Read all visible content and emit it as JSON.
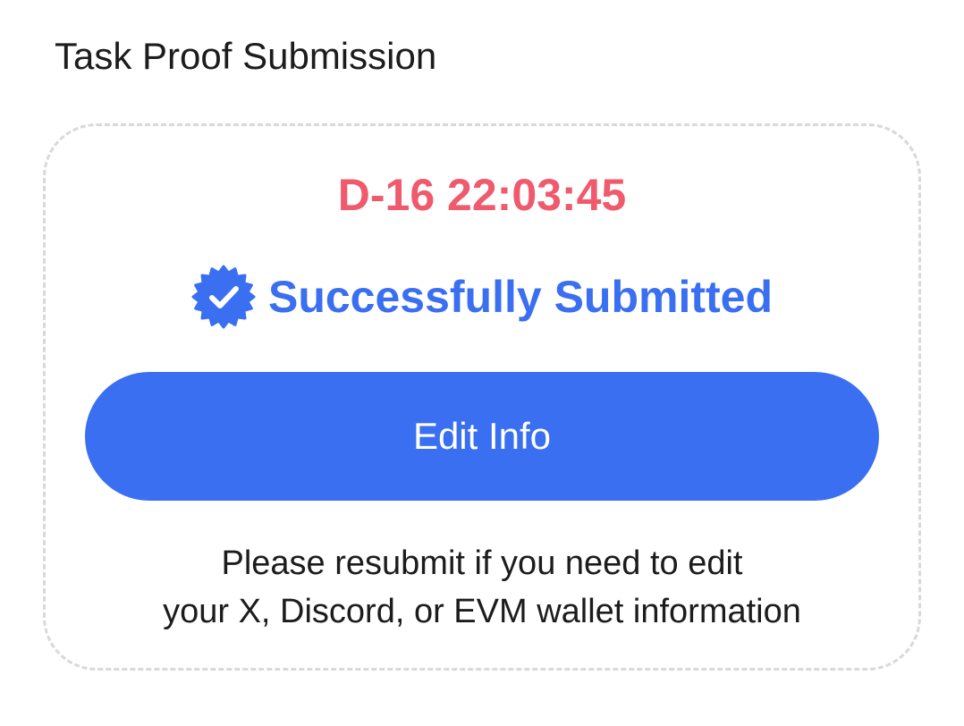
{
  "section": {
    "title": "Task Proof Submission"
  },
  "card": {
    "countdown": "D-16 22:03:45",
    "status": {
      "icon": "verified-badge-icon",
      "text": "Successfully Submitted"
    },
    "edit_button_label": "Edit Info",
    "hint_line_1": "Please resubmit if you need to edit",
    "hint_line_2": "your X, Discord, or EVM wallet information"
  },
  "colors": {
    "countdown": "#ef5a6d",
    "accent": "#3a6ff2",
    "card_border": "#d9d9d9",
    "text": "#1c1c1c"
  }
}
